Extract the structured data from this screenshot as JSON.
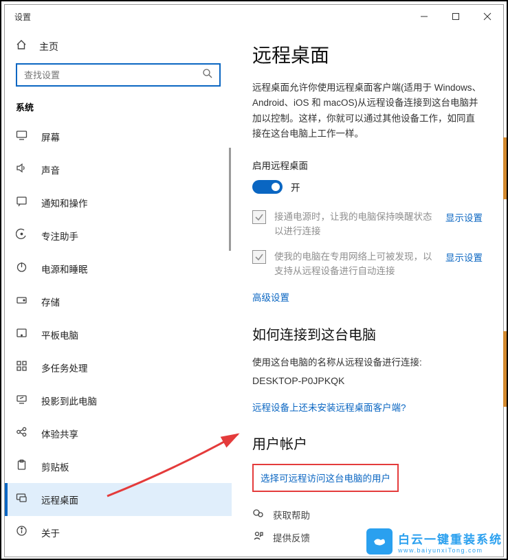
{
  "window": {
    "title": "设置"
  },
  "sidebar": {
    "home": "主页",
    "search_placeholder": "查找设置",
    "group": "系统",
    "items": [
      {
        "label": "屏幕"
      },
      {
        "label": "声音"
      },
      {
        "label": "通知和操作"
      },
      {
        "label": "专注助手"
      },
      {
        "label": "电源和睡眠"
      },
      {
        "label": "存储"
      },
      {
        "label": "平板电脑"
      },
      {
        "label": "多任务处理"
      },
      {
        "label": "投影到此电脑"
      },
      {
        "label": "体验共享"
      },
      {
        "label": "剪贴板"
      },
      {
        "label": "远程桌面"
      },
      {
        "label": "关于"
      }
    ],
    "active_index": 11
  },
  "main": {
    "title": "远程桌面",
    "description": "远程桌面允许你使用远程桌面客户端(适用于 Windows、Android、iOS 和 macOS)从远程设备连接到这台电脑并加以控制。这样，你就可以通过其他设备工作，如同直接在这台电脑上工作一样。",
    "enable_label": "启用远程桌面",
    "toggle_state": "开",
    "option1": "接通电源时，让我的电脑保持唤醒状态以进行连接",
    "option2": "使我的电脑在专用网络上可被发现，以支持从远程设备进行自动连接",
    "show_settings": "显示设置",
    "advanced": "高级设置",
    "connect_title": "如何连接到这台电脑",
    "connect_desc": "使用这台电脑的名称从远程设备进行连接:",
    "device_name": "DESKTOP-P0JPKQK",
    "no_client": "远程设备上还未安装远程桌面客户端?",
    "accounts_title": "用户帐户",
    "select_users": "选择可远程访问这台电脑的用户",
    "get_help": "获取帮助",
    "feedback": "提供反馈"
  },
  "watermark": {
    "text": "白云一键重装系统",
    "url": "www.baiyunxiTong.com"
  }
}
